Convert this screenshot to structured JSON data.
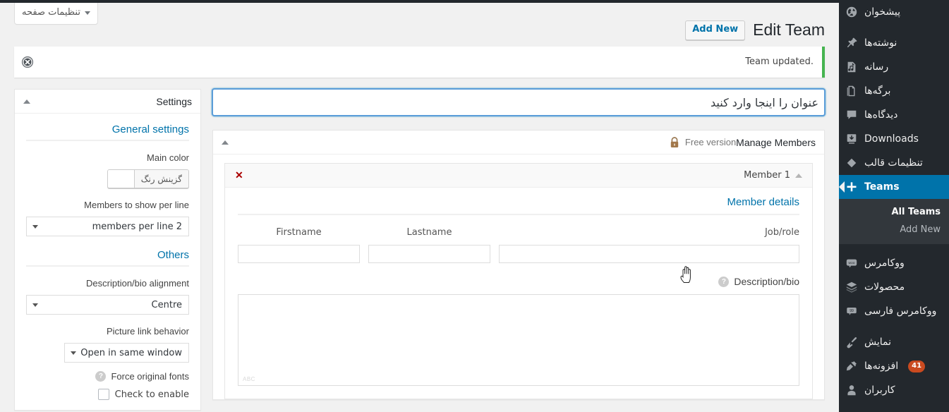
{
  "screen_options": {
    "label": "تنظیمات صفحه"
  },
  "page": {
    "title": "Edit Team",
    "add_new": "Add New"
  },
  "notice": {
    "message": ".Team updated",
    "dismiss_icon": "dismiss-circle-icon",
    "accent_color": "#46b450"
  },
  "title_field": {
    "placeholder": "عنوان را اینجا وارد کنید",
    "value": ""
  },
  "members_box": {
    "title": "Manage Members",
    "subtitle": "Free version",
    "lock_icon": "lock-icon",
    "toggle_icon": "caret-up-icon",
    "member": {
      "name": "Member 1",
      "collapse_icon": "caret-up-icon",
      "remove_icon": "close-x-icon",
      "remove_label": "✕",
      "tab": "Member details",
      "fields": [
        {
          "label": "Firstname",
          "value": "",
          "name": "firstname"
        },
        {
          "label": "Lastname",
          "value": "",
          "name": "lastname"
        },
        {
          "label": "Job/role",
          "value": "",
          "name": "jobrole"
        }
      ],
      "bio_label": "Description/bio",
      "bio_help_icon": "help-icon",
      "bio_value": "",
      "spellcheck_hint": "ABC"
    }
  },
  "settings_box": {
    "title": "Settings",
    "toggle_icon": "caret-up-icon",
    "tabs": [
      {
        "label": "General settings"
      },
      {
        "label": "Others"
      }
    ],
    "main_color": {
      "label": "Main color",
      "button": "گزینش رنگ",
      "swatch": "#ffffff"
    },
    "members_per_line": {
      "label": "Members to show per line",
      "value": "members per line 2"
    },
    "bio_alignment": {
      "label": "Description/bio alignment",
      "value": "Centre"
    },
    "picture_link": {
      "label": "Picture link behavior",
      "value": "Open in same window"
    },
    "force_fonts": {
      "label": "Force original fonts",
      "help_icon": "help-icon",
      "check_label": "Check to enable",
      "checked": false
    }
  },
  "sidebar": {
    "accent_color": "#0073aa",
    "items": [
      {
        "label": "پیشخوان",
        "icon": "dashboard-icon",
        "current": false
      },
      {
        "label": "نوشته‌ها",
        "icon": "pin-icon",
        "current": false
      },
      {
        "label": "رسانه",
        "icon": "media-icon",
        "current": false
      },
      {
        "label": "برگه‌ها",
        "icon": "pages-icon",
        "current": false
      },
      {
        "label": "دیدگاه‌ها",
        "icon": "comment-icon",
        "current": false
      },
      {
        "label": "Downloads",
        "icon": "download-icon",
        "current": false
      },
      {
        "label": "تنظیمات قالب",
        "icon": "diamond-icon",
        "current": false
      },
      {
        "label": "Teams",
        "icon": "plus-icon",
        "current": true
      }
    ],
    "teams_submenu": [
      {
        "label": "All Teams",
        "current": true
      },
      {
        "label": "Add New",
        "current": false
      }
    ],
    "items2": [
      {
        "label": "ووکامرس",
        "icon": "woo-icon",
        "current": false
      },
      {
        "label": "محصولات",
        "icon": "products-icon",
        "current": false
      },
      {
        "label": "ووکامرس فارسی",
        "icon": "woo-fa-icon",
        "current": false
      }
    ],
    "items3": [
      {
        "label": "نمایش",
        "icon": "appearance-icon",
        "current": false,
        "badge": ""
      },
      {
        "label": "افزونه‌ها",
        "icon": "plugins-icon",
        "current": false,
        "badge": "41"
      },
      {
        "label": "کاربران",
        "icon": "users-icon",
        "current": false,
        "badge": ""
      }
    ]
  }
}
